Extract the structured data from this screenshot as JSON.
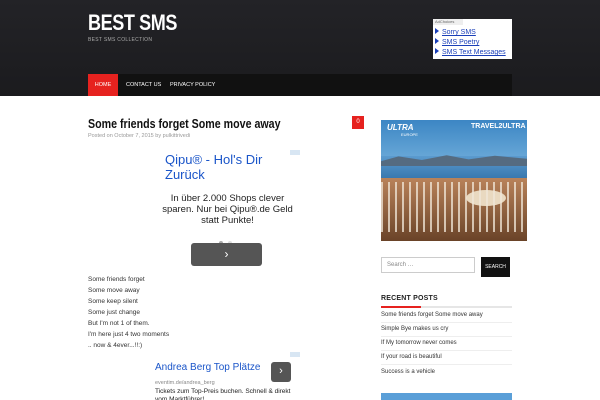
{
  "site": {
    "title": "BEST SMS",
    "description": "BEST SMS COLLECTION"
  },
  "header_ad": {
    "adchoices": "AdChoices",
    "links": [
      "Sorry SMS",
      "SMS Poetry",
      "SMS Text Messages"
    ]
  },
  "nav": {
    "items": [
      "HOME",
      "CONTACT US",
      "PRIVACY POLICY"
    ]
  },
  "post": {
    "title": "Some friends forget Some move away",
    "meta": "Posted on October 7, 2015 by pulkittrivedi",
    "comment_count": "0",
    "lines": [
      "Some friends forget",
      "Some move away",
      "Some keep silent",
      "Some just change",
      "But I'm not 1 of them.",
      "I'm here just 4 two moments",
      ".. now & 4ever...!!:)"
    ]
  },
  "ad_one": {
    "title": "Qipu® - Hol's Dir Zurück",
    "body": "In über 2.000 Shops clever sparen. Nur bei Qipu®.de Geld statt Punkte!",
    "button_glyph": "›",
    "dot_colors": [
      "#aaaaaa",
      "#dddddd"
    ]
  },
  "ad_two": {
    "title": "Andrea Berg Top Plätze",
    "url": "eventim.de/andrea_berg",
    "description": "Tickets zum Top-Preis buchen. Schnell & direkt vom Marktführer!",
    "button_glyph": "›"
  },
  "banner": {
    "brand_left": "ULTRA",
    "brand_left_sub": "EUROPE",
    "brand_right": "TRAVEL2ULTRA"
  },
  "search": {
    "placeholder": "Search …",
    "button": "SEARCH"
  },
  "recent_posts": {
    "title": "RECENT POSTS",
    "items": [
      "Some friends forget Some move away",
      "Simple Bye makes us cry",
      "If My tomorrow never comes",
      "If your road is beautiful",
      "Success is a vehicle"
    ]
  },
  "colors": {
    "accent": "#e6221f",
    "header_bg": "#1f1f22",
    "link_blue": "#1a55c9"
  }
}
